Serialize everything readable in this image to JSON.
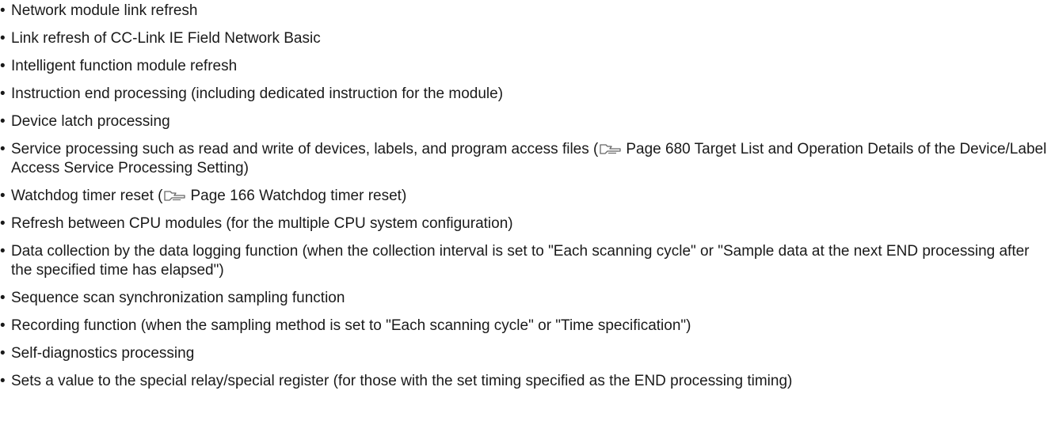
{
  "items": [
    {
      "text": "Network module link refresh"
    },
    {
      "text": "Link refresh of CC-Link IE Field Network Basic"
    },
    {
      "text": "Intelligent function module refresh"
    },
    {
      "text": "Instruction end processing (including dedicated instruction for the module)"
    },
    {
      "text": "Device latch processing"
    },
    {
      "before": "Service processing such as read and write of devices, labels, and program access files (",
      "ref": "Page 680 Target List and Operation Details of the Device/Label Access Service Processing Setting)"
    },
    {
      "before": "Watchdog timer reset (",
      "ref": "Page 166 Watchdog timer reset)"
    },
    {
      "text": "Refresh between CPU modules (for the multiple CPU system configuration)"
    },
    {
      "text": "Data collection by the data logging function (when the collection interval is set to \"Each scanning cycle\" or \"Sample data at the next END processing after the specified time has elapsed\")"
    },
    {
      "text": "Sequence scan synchronization sampling function"
    },
    {
      "text": "Recording function (when the sampling method is set to \"Each scanning cycle\" or \"Time specification\")"
    },
    {
      "text": "Self-diagnostics processing"
    },
    {
      "text": "Sets a value to the special relay/special register (for those with the set timing specified as the END processing timing)"
    }
  ],
  "bullet": "•",
  "icons": {
    "reference": "pointing-hand-icon"
  }
}
